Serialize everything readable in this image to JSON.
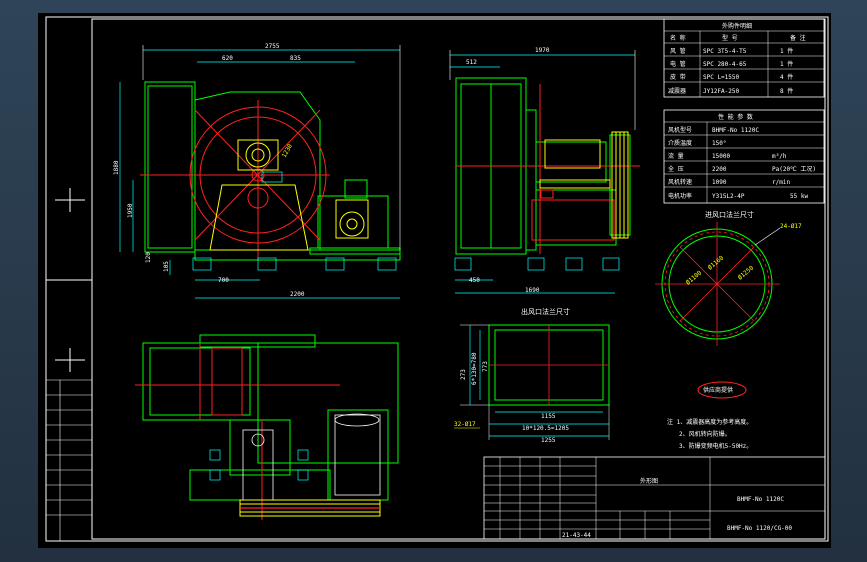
{
  "colors": {
    "frame": "#ffffff",
    "green": "#00ff00",
    "red": "#ff2020",
    "yellow": "#ffff00",
    "cyan": "#00ffff",
    "white": "#ffffff",
    "blue": "#2040ff"
  },
  "parts_table": {
    "title": "外购件明细",
    "headers": [
      "名 称",
      "型 号",
      "备 注"
    ],
    "rows": [
      [
        "风 管",
        "SPC 3T5-4-T5",
        "1 件"
      ],
      [
        "电 管",
        "SPC 280-4-65",
        "1 件"
      ],
      [
        "皮 带",
        "SPC L=1550",
        "4 件"
      ],
      [
        "减震器",
        "JY12FA-250",
        "8 件"
      ]
    ]
  },
  "perf_table": {
    "title": "性 能 参 数",
    "rows": [
      [
        "风机型号",
        "BHMF-No 1120C",
        ""
      ],
      [
        "介质温度",
        "150°",
        ""
      ],
      [
        "流 量",
        "15000",
        "m³/h"
      ],
      [
        "全 压",
        "2200",
        "Pa(20℃ 工况)"
      ],
      [
        "风机转速",
        "1090",
        "r/min"
      ],
      [
        "电机功率",
        "Y315L2-4P",
        "55 kw"
      ]
    ]
  },
  "inlet_flange": {
    "title": "进风口法兰尺寸",
    "holes": "24-Ø17",
    "d1": "Ø1160",
    "d2": "Ø1100",
    "d3": "Ø1250"
  },
  "outlet_flange": {
    "title": "出风口法兰尺寸",
    "dims": [
      "1155",
      "10*120.5=1205",
      "1255",
      "273",
      "6*130=780",
      "773"
    ],
    "holes": "32-Ø17"
  },
  "front_view": {
    "dims": [
      "2755",
      "620",
      "835",
      "1880",
      "1950",
      "1230",
      "700",
      "2200",
      "120",
      "105"
    ]
  },
  "side_view": {
    "dims": [
      "1970",
      "512",
      "450",
      "1690"
    ]
  },
  "stamp": "供应商提供",
  "notes": [
    "注 1、减震器高度为参考高度。",
    "2、风机转向防爆。",
    "3、防爆变频电机5-50Hz。"
  ],
  "title_block": {
    "name": "外形图",
    "model": "BHMF-No 1120C",
    "drawing_no": "BHMF-No 1120/CG-00",
    "misc": "21-43-44"
  }
}
